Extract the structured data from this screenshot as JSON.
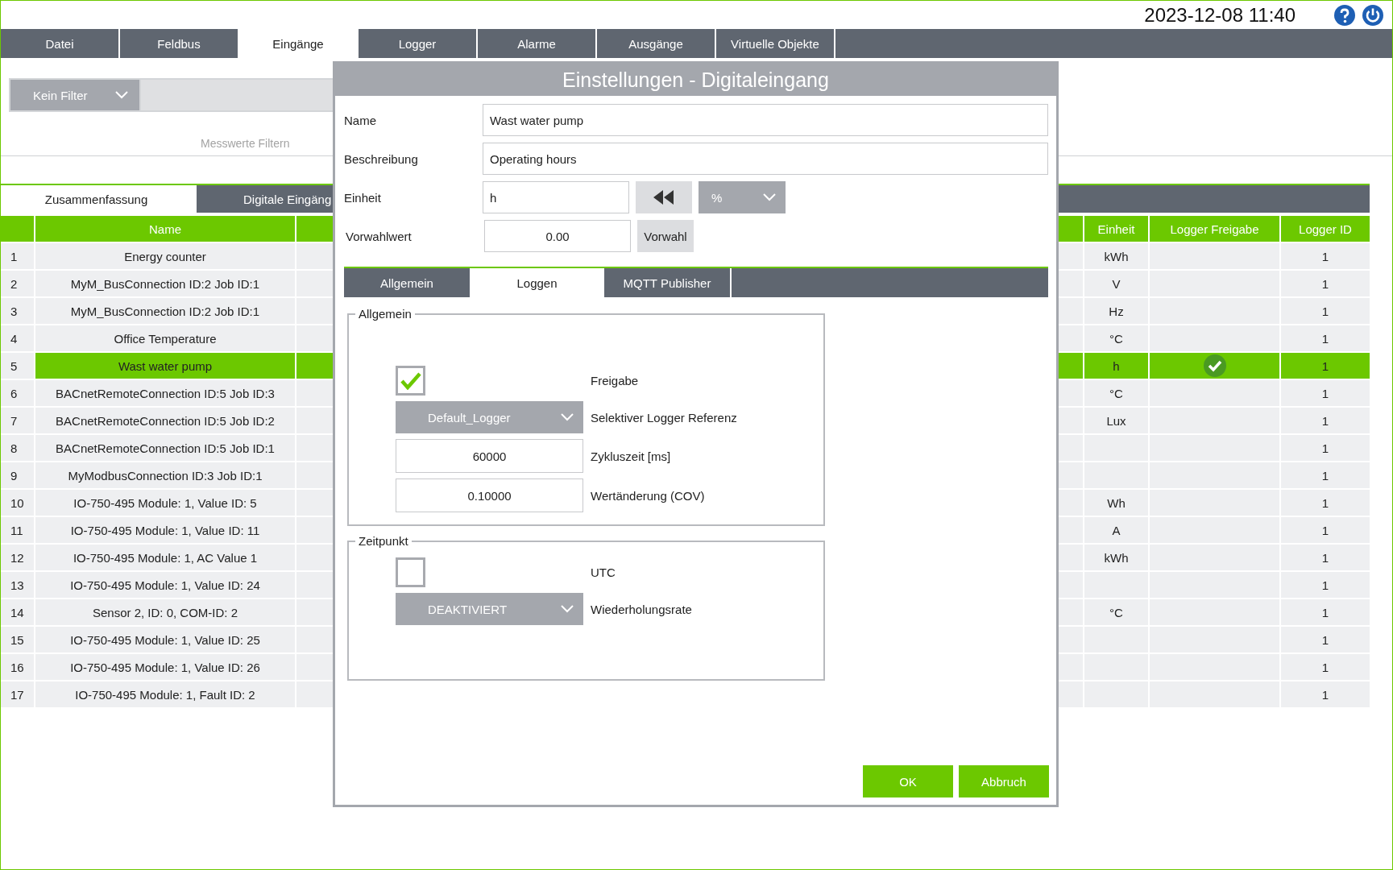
{
  "header": {
    "clock": "2023-12-08 11:40"
  },
  "nav_tabs": [
    {
      "label": "Datei",
      "selected": false
    },
    {
      "label": "Feldbus",
      "selected": false
    },
    {
      "label": "Eingänge",
      "selected": true
    },
    {
      "label": "Logger",
      "selected": false
    },
    {
      "label": "Alarme",
      "selected": false
    },
    {
      "label": "Ausgänge",
      "selected": false
    },
    {
      "label": "Virtuelle Objekte",
      "selected": false
    }
  ],
  "filter": {
    "dropdown": "Kein Filter",
    "caption": "Messwerte Filtern"
  },
  "sub_tabs": [
    {
      "label": "Zusammenfassung",
      "selected": true
    },
    {
      "label": "Digitale Eingäng",
      "selected": false
    }
  ],
  "table": {
    "columns": {
      "name": "Name",
      "unit": "Einheit",
      "logger_enabled": "Logger Freigabe",
      "logger_id": "Logger ID"
    },
    "rows": [
      {
        "index": "1",
        "name": "Energy counter",
        "unit": "kWh",
        "logger_enabled": false,
        "logger_id": "1",
        "selected": false
      },
      {
        "index": "2",
        "name": "MyM_BusConnection ID:2 Job ID:1",
        "unit": "V",
        "logger_enabled": false,
        "logger_id": "1",
        "selected": false
      },
      {
        "index": "3",
        "name": "MyM_BusConnection ID:2 Job ID:1",
        "unit": "Hz",
        "logger_enabled": false,
        "logger_id": "1",
        "selected": false
      },
      {
        "index": "4",
        "name": "Office Temperature",
        "unit": "°C",
        "logger_enabled": false,
        "logger_id": "1",
        "selected": false
      },
      {
        "index": "5",
        "name": "Wast water pump",
        "unit": "h",
        "logger_enabled": true,
        "logger_id": "1",
        "selected": true
      },
      {
        "index": "6",
        "name": "BACnetRemoteConnection ID:5 Job ID:3",
        "unit": "°C",
        "logger_enabled": false,
        "logger_id": "1",
        "selected": false
      },
      {
        "index": "7",
        "name": "BACnetRemoteConnection ID:5 Job ID:2",
        "unit": "Lux",
        "logger_enabled": false,
        "logger_id": "1",
        "selected": false
      },
      {
        "index": "8",
        "name": "BACnetRemoteConnection ID:5 Job ID:1",
        "logger_enabled": false,
        "logger_id": "1",
        "selected": false
      },
      {
        "index": "9",
        "name": "MyModbusConnection ID:3 Job ID:1",
        "logger_enabled": false,
        "logger_id": "1",
        "selected": false
      },
      {
        "index": "10",
        "name": "IO-750-495 Module: 1, Value ID: 5",
        "unit": "Wh",
        "logger_enabled": false,
        "logger_id": "1",
        "selected": false
      },
      {
        "index": "11",
        "name": "IO-750-495 Module: 1, Value ID: 11",
        "unit": "A",
        "logger_enabled": false,
        "logger_id": "1",
        "selected": false
      },
      {
        "index": "12",
        "name": "IO-750-495 Module: 1, AC Value 1",
        "unit": "kWh",
        "logger_enabled": false,
        "logger_id": "1",
        "selected": false
      },
      {
        "index": "13",
        "name": "IO-750-495 Module: 1, Value ID: 24",
        "logger_enabled": false,
        "logger_id": "1",
        "selected": false
      },
      {
        "index": "14",
        "name": "Sensor 2, ID: 0, COM-ID: 2",
        "unit": "°C",
        "logger_enabled": false,
        "logger_id": "1",
        "selected": false
      },
      {
        "index": "15",
        "name": "IO-750-495 Module: 1, Value ID: 25",
        "logger_enabled": false,
        "logger_id": "1",
        "selected": false
      },
      {
        "index": "16",
        "name": "IO-750-495 Module: 1, Value ID: 26",
        "logger_enabled": false,
        "logger_id": "1",
        "selected": false
      },
      {
        "index": "17",
        "name": "IO-750-495 Module: 1, Fault ID: 2",
        "logger_enabled": false,
        "logger_id": "1",
        "selected": false
      }
    ]
  },
  "dialog": {
    "title": "Einstellungen - Digitaleingang",
    "name": {
      "label": "Name",
      "value": "Wast water pump"
    },
    "description": {
      "label": "Beschreibung",
      "value": "Operating hours"
    },
    "unit": {
      "label": "Einheit",
      "value": "h",
      "select": "%"
    },
    "preset": {
      "label": "Vorwahlwert",
      "value": "0.00",
      "button": "Vorwahl"
    },
    "tabs": [
      {
        "label": "Allgemein",
        "selected": false
      },
      {
        "label": "Loggen",
        "selected": true
      },
      {
        "label": "MQTT Publisher",
        "selected": false
      }
    ],
    "groups": [
      {
        "title": "Allgemein",
        "items": [
          {
            "kind": "checkbox",
            "label": "Freigabe",
            "checked": true
          },
          {
            "kind": "dropdown",
            "value": "Default_Logger",
            "label": "Selektiver Logger Referenz"
          },
          {
            "kind": "input",
            "value": "60000",
            "label": "Zykluszeit [ms]"
          },
          {
            "kind": "input",
            "value": "0.10000",
            "label": "Wertänderung (COV)"
          }
        ]
      },
      {
        "title": "Zeitpunkt",
        "items": [
          {
            "kind": "checkbox",
            "label": "UTC",
            "checked": false
          },
          {
            "kind": "dropdown",
            "value": "DEAKTIVIERT",
            "label": "Wiederholungsrate"
          }
        ]
      }
    ],
    "buttons": [
      "OK",
      "Abbruch"
    ]
  }
}
